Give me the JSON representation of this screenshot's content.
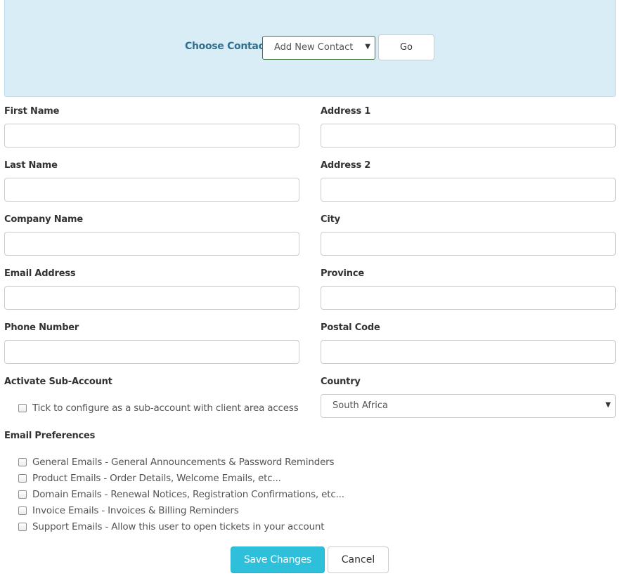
{
  "contact_chooser": {
    "label": "Choose Contact",
    "selected": "Add New Contact",
    "go_label": "Go"
  },
  "fields": {
    "first_name": {
      "label": "First Name",
      "value": ""
    },
    "last_name": {
      "label": "Last Name",
      "value": ""
    },
    "company_name": {
      "label": "Company Name",
      "value": ""
    },
    "email_address": {
      "label": "Email Address",
      "value": ""
    },
    "phone_number": {
      "label": "Phone Number",
      "value": ""
    },
    "address1": {
      "label": "Address 1",
      "value": ""
    },
    "address2": {
      "label": "Address 2",
      "value": ""
    },
    "city": {
      "label": "City",
      "value": ""
    },
    "province": {
      "label": "Province",
      "value": ""
    },
    "postal_code": {
      "label": "Postal Code",
      "value": ""
    },
    "country": {
      "label": "Country",
      "selected": "South Africa"
    }
  },
  "sub_account": {
    "heading": "Activate Sub-Account",
    "checkbox_label": "Tick to configure as a sub-account with client area access",
    "checked": false
  },
  "email_preferences": {
    "heading": "Email Preferences",
    "items": [
      {
        "label": "General Emails - General Announcements & Password Reminders",
        "checked": false
      },
      {
        "label": "Product Emails - Order Details, Welcome Emails, etc...",
        "checked": false
      },
      {
        "label": "Domain Emails - Renewal Notices, Registration Confirmations, etc...",
        "checked": false
      },
      {
        "label": "Invoice Emails - Invoices & Billing Reminders",
        "checked": false
      },
      {
        "label": "Support Emails - Allow this user to open tickets in your account",
        "checked": false
      }
    ]
  },
  "actions": {
    "save_label": "Save Changes",
    "cancel_label": "Cancel"
  },
  "colors": {
    "panel_bg": "#d9edf7",
    "panel_label": "#31708f",
    "primary_button": "#2ec0db"
  }
}
